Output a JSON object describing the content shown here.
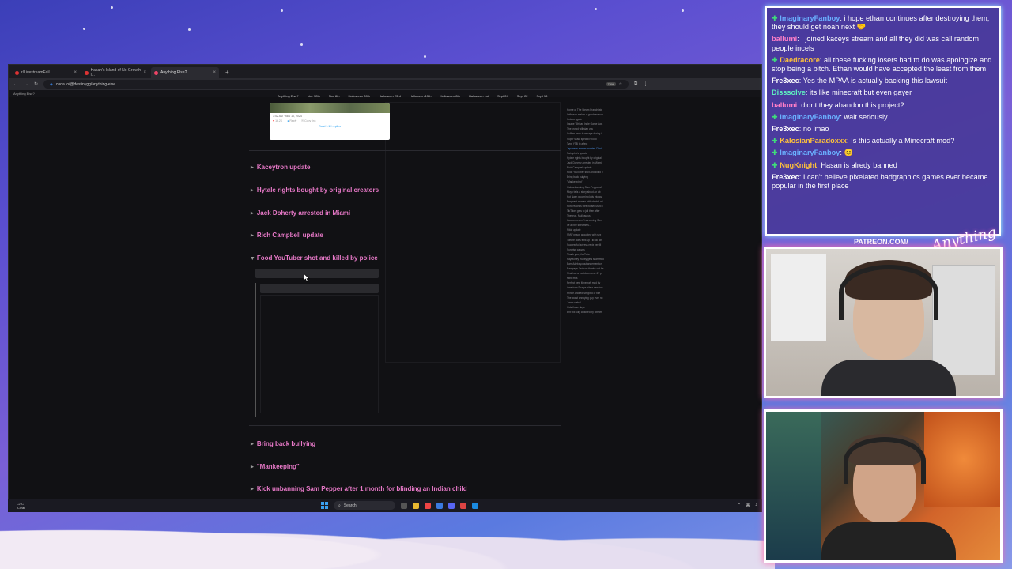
{
  "browser": {
    "tabs": [
      {
        "label": "r/LivestreamFail"
      },
      {
        "label": "Hasan's Island of No Growth i..."
      },
      {
        "label": "Anything Else?"
      }
    ],
    "new_tab": "+",
    "url": "coda.io/@destinygg/anything-else",
    "zoom": "75%",
    "page_header": "Anything Else?",
    "nav_links": [
      "Anything Else?",
      "Nov 12th",
      "Nov 8th",
      "Halloween 28th",
      "Halloween 23rd",
      "Halloween 15th",
      "Halloween 8th",
      "Halloween 1st",
      "Sept 24",
      "Sept 22",
      "Sept 18"
    ]
  },
  "embed": {
    "meta": "3:42 AM · Nov 10, 2024",
    "likes": "16.2K",
    "reply": "Reply",
    "copy": "Copy link",
    "read_replies": "Read 1.1K replies"
  },
  "toggles": [
    {
      "label": "Kaceytron update",
      "open": false
    },
    {
      "label": "Hytale rights bought by original creators",
      "open": false
    },
    {
      "label": "Jack Doherty arrested in Miami",
      "open": false
    },
    {
      "label": "Rich Campbell update",
      "open": false
    },
    {
      "label": "Food YouTuber shot and killed by police",
      "open": true
    },
    {
      "label": "Bring back bullying",
      "open": false
    },
    {
      "label": "\"Mankeeping\"",
      "open": false
    },
    {
      "label": "Kick unbanning Sam Pepper after 1 month for blinding an Indian child",
      "open": false
    }
  ],
  "toc": [
    "Home of The Steam Franchi str",
    "Valhyson makes a goodness roo",
    "Kotaku ggwin",
    "Insane 'African Indie Game Awa",
    "The crowd will stab you",
    "Cuffem work to escape during i",
    "Super scala special record",
    "Type YTB to affect",
    "Japanese stream marries Chat",
    "Naimpha's update",
    "Hytale rights bought by original",
    "Jack Doherty arrested in Miami",
    "Rich Campbell update",
    "Food YouTuber shot and killed b",
    "Bring back bullying",
    "\"Mankeeping\"",
    "Kick unbanning Sam Pepper aft",
    "Moyo tells a story about an ab",
    "Hot Nash grooming kids into av",
    "Pregnant woman with stretch-mi",
    "Ford reaches steel to sell used c",
    "TikToker gets to jail then after",
    "Theseus, Mulleaurus",
    "Quorum's aren't screening Sun",
    "Of all the streamers...",
    "Nikki update",
    "SNW prison acquitted with sex",
    "Torture does funk up TikTok stri",
    "Successful actress revix her M",
    "Surprise casvas",
    "Thank you, YouTube",
    "PayMoney Hubby gets scammed",
    "Bam Adebayo outlandement on",
    "Rampage Jackson thanks out for",
    "Shai has a meltdown over 67 yr",
    "Mink mxs",
    "Perfect new Minecraft mod by",
    "American Sharps hits a new low",
    "Prince Andrew stripped of title",
    "The worst annoying guy ever no",
    "Jonez slehol",
    "Kids these days",
    "Ent still fully clutched by stream"
  ],
  "toc_highlight_index": 8,
  "taskbar": {
    "weather_temp": "-2°C",
    "weather_desc": "Clear",
    "search": "Search"
  },
  "chat": [
    {
      "user": "ImaginaryFanboy",
      "text": "i hope ethan continues after destroying them, they should get noah next 🤝",
      "color": "#6ab0ff",
      "badge": true
    },
    {
      "user": "ballumi",
      "text": "I joined kaceys stream and all they did was call random people incels",
      "color": "#ff7fc8",
      "badge": false
    },
    {
      "user": "Daedracore",
      "text": "all these fucking losers had to do was apologize and stop being a bitch. Ethan would have accepted the least from them.",
      "color": "#ffc23a",
      "badge": true
    },
    {
      "user": "Fre3xec",
      "text": "Yes the MPAA is actually backing this lawsuit",
      "color": "#ffffff",
      "badge": false
    },
    {
      "user": "Disssolve",
      "text": "its like minecraft but even gayer",
      "color": "#5ef0c0",
      "badge": false
    },
    {
      "user": "ballumi",
      "text": "didnt they abandon this project?",
      "color": "#ff7fc8",
      "badge": false
    },
    {
      "user": "ImaginaryFanboy",
      "text": "wait seriously",
      "color": "#6ab0ff",
      "badge": true
    },
    {
      "user": "Fre3xec",
      "text": "no lmao",
      "color": "#ffffff",
      "badge": false
    },
    {
      "user": "KalosianParadoxxx",
      "text": "Is this actually a Minecraft mod?",
      "color": "#ffc23a",
      "badge": true
    },
    {
      "user": "ImaginaryFanboy",
      "text": "😊",
      "color": "#6ab0ff",
      "badge": true
    },
    {
      "user": "NugKnight",
      "text": "Hasan is alredy banned",
      "color": "#ffc23a",
      "badge": true
    },
    {
      "user": "Fre3xec",
      "text": "I can't believe pixelated badgraphics games ever became popular in the first place",
      "color": "#ffffff",
      "badge": false
    }
  ],
  "overlay": {
    "patreon": "PATREON.COM/",
    "brand": "Anything Else?"
  }
}
